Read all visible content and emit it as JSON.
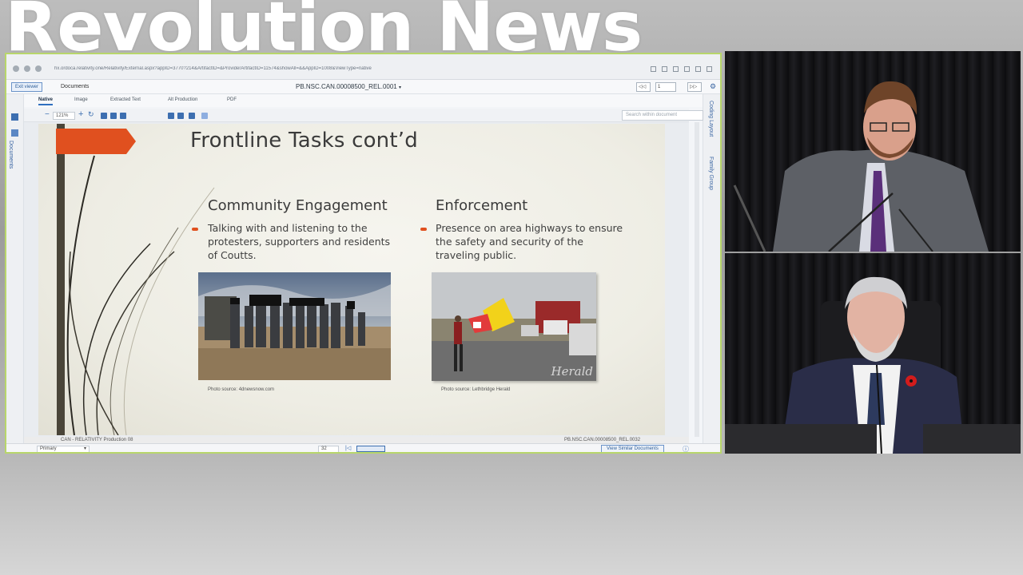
{
  "watermark": "Revolution News",
  "browser": {
    "url": "hx.ordoca.relativity.one/Relativity/External.aspx?appID=3770?214&ArtifactID=&ProviderArtifactID=11574&showAll=&&AppID=1008&ViewType=native"
  },
  "doc_header": {
    "exit_label": "Exit viewer",
    "documents_label": "Documents",
    "doc_title": "PB.NSC.CAN.00008500_REL.0001",
    "page_value": "1"
  },
  "tabs": [
    "Native",
    "Image",
    "Extracted Text",
    "Alt Production",
    "PDF"
  ],
  "toolbar": {
    "zoom": "121%",
    "search_placeholder": "Search within document"
  },
  "left_rail": {
    "label": "Documents"
  },
  "right_rail": {
    "coding_label": "Coding Layout",
    "family_label": "Family Group"
  },
  "slide": {
    "title": "Frontline Tasks cont’d",
    "left": {
      "heading": "Community Engagement",
      "body": "Talking with and listening to the protesters, supporters and residents of Coutts.",
      "caption": "Photo source: 4dnewsnow.com"
    },
    "right": {
      "heading": "Enforcement",
      "body": "Presence on area highways to ensure the safety and security of the traveling public.",
      "caption": "Photo source: Lethbridge Herald",
      "herald": "Herald"
    }
  },
  "status": {
    "left": "CAN - RELATIVITY Production 08",
    "right": "PB.NSC.CAN.00008500_REL.0032"
  },
  "bottom_bar": {
    "primary": "Primary",
    "page_number": "32",
    "similar": "View Similar Documents"
  },
  "colors": {
    "share_border": "#b8d66b",
    "accent_orange": "#e0501f",
    "relativity_blue": "#3b66a3",
    "poppy_red": "#d21c1c"
  }
}
